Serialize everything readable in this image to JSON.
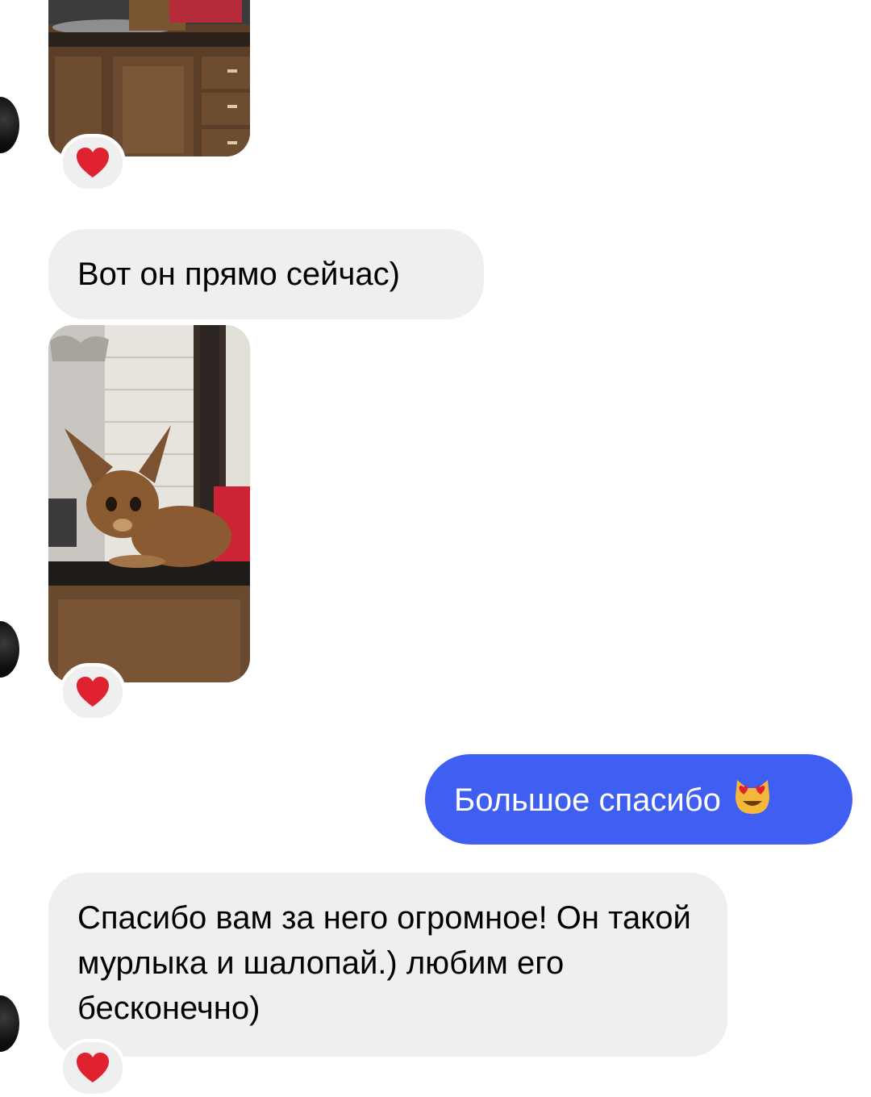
{
  "conversation": {
    "messages": [
      {
        "id": "photo-1",
        "sender": "contact",
        "type": "image",
        "description": "partial photo of a wooden cabinet with a countertop",
        "reaction": "❤️"
      },
      {
        "id": "text-1",
        "sender": "contact",
        "type": "text",
        "text": "Вот он прямо сейчас)"
      },
      {
        "id": "photo-2",
        "sender": "contact",
        "type": "image",
        "description": "abyssinian cat sitting on a dark countertop",
        "reaction": "❤️"
      },
      {
        "id": "text-2",
        "sender": "me",
        "type": "text",
        "text": "Большое спасибо",
        "emoji": "😻"
      },
      {
        "id": "text-3",
        "sender": "contact",
        "type": "text",
        "text": "Спасибо вам за него огромное! Он такой мурлыка и шалопай.) любим его бесконечно)",
        "reaction": "❤️"
      }
    ]
  },
  "colors": {
    "incoming_bubble": "#efefef",
    "outgoing_bubble": "#3f5ef2",
    "reaction_heart": "#e0212f"
  }
}
